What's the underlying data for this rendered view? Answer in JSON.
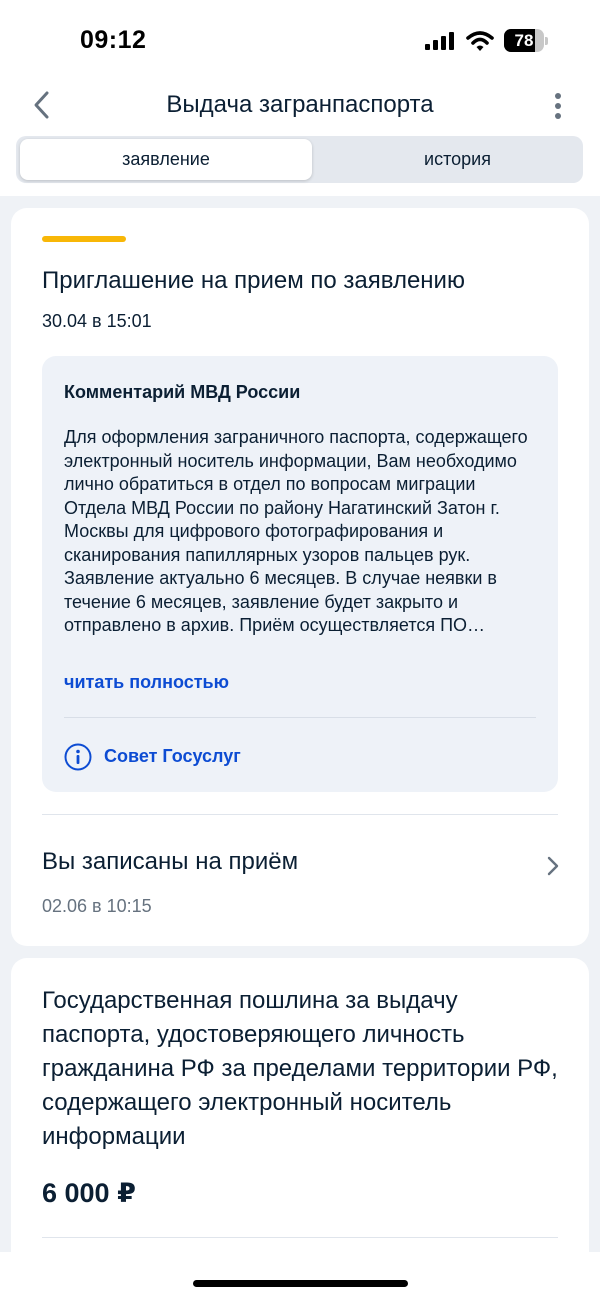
{
  "status_bar": {
    "time": "09:12",
    "battery_level": "78",
    "battery_fraction": 0.78
  },
  "header": {
    "title": "Выдача загранпаспорта",
    "back_icon": "chevron-left-icon",
    "menu_icon": "more-vertical-icon"
  },
  "tabs": [
    {
      "label": "заявление",
      "active": true
    },
    {
      "label": "история",
      "active": false
    }
  ],
  "event": {
    "title": "Приглашение на прием по заявлению",
    "date": "30.04 в 15:01",
    "status_color": "#f8b707",
    "comment": {
      "heading": "Комментарий МВД России",
      "text": "Для оформления заграничного паспорта, содержащего электронный носитель информации, Вам необходимо лично обратиться в отдел по вопросам миграции Отдела МВД России по району Нагатинский Затон г. Москвы для цифрового фотографирования и сканирования папиллярных узоров пальцев рук. Заявление актуально 6 месяцев. В случае неявки в течение 6 месяцев, заявление будет закрыто и отправлено в архив. Приём осуществляется ПО…",
      "read_more": "читать полностью",
      "tip_label": "Совет Госуслуг",
      "tip_icon": "info-icon"
    }
  },
  "appointment": {
    "title": "Вы записаны на приём",
    "date": "02.06 в 10:15",
    "icon": "chevron-right-icon"
  },
  "fee": {
    "title": "Государственная пошлина за выдачу паспорта, удостоверяющего личность гражданина РФ за пределами территории РФ, содержащего электронный носитель информации",
    "amount": "6 000 ₽"
  },
  "colors": {
    "accent": "#0d4cd3",
    "background": "#eff2f6",
    "text": "#0b1f33",
    "secondary_text": "#66727f"
  }
}
